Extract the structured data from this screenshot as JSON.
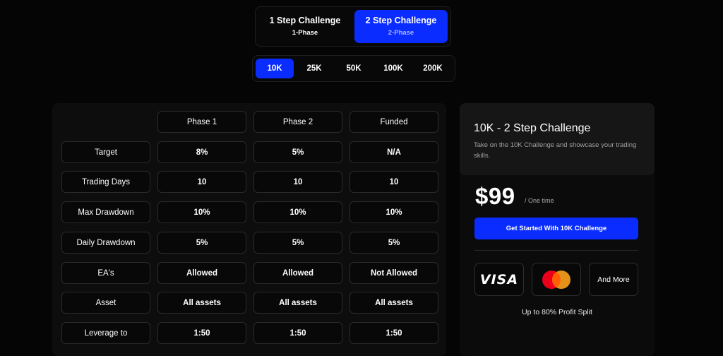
{
  "challenge_type": {
    "options": [
      {
        "label": "1 Step Challenge",
        "sub": "1-Phase",
        "active": false
      },
      {
        "label": "2 Step Challenge",
        "sub": "2-Phase",
        "active": true
      }
    ]
  },
  "account_size": {
    "options": [
      "10K",
      "25K",
      "50K",
      "100K",
      "200K"
    ],
    "selected": "10K"
  },
  "table": {
    "columns": [
      "Phase 1",
      "Phase 2",
      "Funded"
    ],
    "rows": [
      {
        "label": "Target",
        "values": [
          "8%",
          "5%",
          "N/A"
        ]
      },
      {
        "label": "Trading Days",
        "values": [
          "10",
          "10",
          "10"
        ]
      },
      {
        "label": "Max Drawdown",
        "values": [
          "10%",
          "10%",
          "10%"
        ]
      },
      {
        "label": "Daily Drawdown",
        "values": [
          "5%",
          "5%",
          "5%"
        ]
      },
      {
        "label": "EA's",
        "values": [
          "Allowed",
          "Allowed",
          "Not Allowed"
        ]
      },
      {
        "label": "Asset",
        "values": [
          "All assets",
          "All assets",
          "All assets"
        ]
      },
      {
        "label": "Leverage to",
        "values": [
          "1:50",
          "1:50",
          "1:50"
        ]
      }
    ]
  },
  "summary": {
    "title": "10K - 2 Step Challenge",
    "description": "Take on the 10K Challenge and showcase your trading skills.",
    "price": "$99",
    "price_note": "/ One time",
    "cta_label": "Get Started With 10K Challenge",
    "payment_methods": {
      "visa": "VISA",
      "more": "And More"
    },
    "profit_split": "Up to 80% Profit Split"
  },
  "colors": {
    "accent": "#0a2cff",
    "background": "#050505",
    "mastercard_red": "#eb001b",
    "mastercard_orange": "#f79e1b"
  }
}
